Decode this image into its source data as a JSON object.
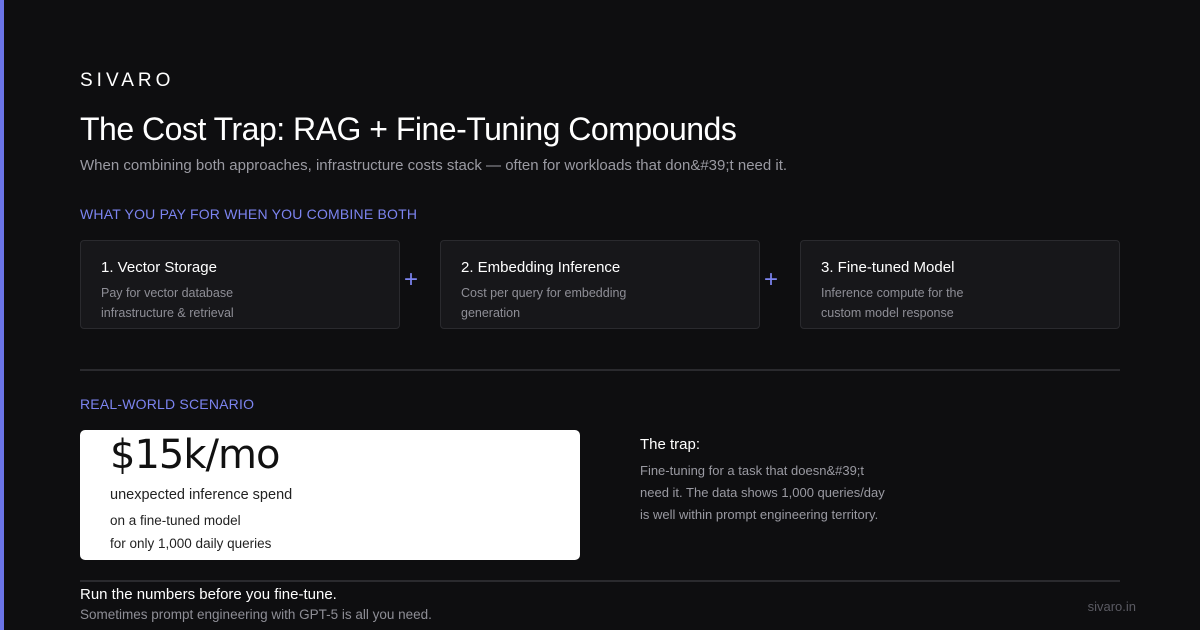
{
  "brand": "SIVARO",
  "title": "The Cost Trap: RAG + Fine-Tuning Compounds",
  "subtitle": "When combining both approaches, infrastructure costs stack — often for workloads that don&#39;t need it.",
  "section1": {
    "label": "WHAT YOU PAY FOR WHEN YOU COMBINE BOTH",
    "cards": [
      {
        "title": "1. Vector Storage",
        "desc": "Pay for vector database infrastructure & retrieval"
      },
      {
        "title": "2. Embedding Inference",
        "desc": "Cost per query for embedding generation"
      },
      {
        "title": "3. Fine-tuned Model",
        "desc": "Inference compute for the custom model response"
      }
    ],
    "plus": "+"
  },
  "section2": {
    "label": "REAL-WORLD SCENARIO",
    "stat": {
      "value": "$15k/mo",
      "line1": "unexpected inference spend",
      "line2": "on a fine-tuned model",
      "line3": "for only 1,000 daily queries"
    },
    "trap": {
      "title": "The trap:",
      "body": "Fine-tuning for a task that doesn&#39;t need it. The data shows 1,000 queries/day is well within prompt engineering territory."
    }
  },
  "footer": {
    "main": "Run the numbers before you fine-tune.",
    "sub": "Sometimes prompt engineering with GPT-5 is all you need.",
    "url": "sivaro.in"
  },
  "colors": {
    "accent": "#7c84f0",
    "background": "#0e0e10",
    "card": "#17171a"
  }
}
